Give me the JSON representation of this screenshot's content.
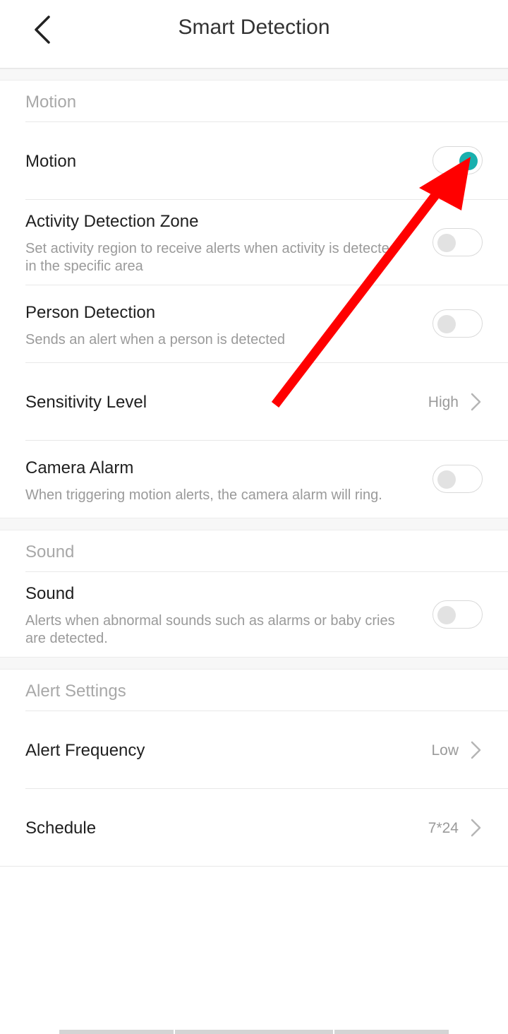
{
  "header": {
    "title": "Smart Detection"
  },
  "sections": {
    "motion": {
      "label": "Motion",
      "motion": {
        "title": "Motion",
        "enabled": true
      },
      "activity_zone": {
        "title": "Activity Detection Zone",
        "desc_line1": "Set activity region to receive alerts when activity is detected",
        "desc_line2": "in the specific area",
        "enabled": false
      },
      "person": {
        "title": "Person Detection",
        "desc": "Sends an alert when a person is detected",
        "enabled": false
      },
      "sensitivity": {
        "title": "Sensitivity Level",
        "value": "High"
      },
      "camera_alarm": {
        "title": "Camera Alarm",
        "desc": "When triggering motion alerts, the camera alarm will ring.",
        "enabled": false
      }
    },
    "sound": {
      "label": "Sound",
      "sound": {
        "title": "Sound",
        "desc_line1": "Alerts when abnormal sounds such as alarms or baby cries",
        "desc_line2": "are detected.",
        "enabled": false
      }
    },
    "alert": {
      "label": "Alert Settings",
      "frequency": {
        "title": "Alert Frequency",
        "value": "Low"
      },
      "schedule": {
        "title": "Schedule",
        "value": "7*24"
      }
    }
  },
  "colors": {
    "toggle_on": "#19b0ae",
    "annotation_arrow": "#ff0000"
  },
  "icons": {
    "back": "chevron-left-icon",
    "disclosure": "chevron-right-icon"
  }
}
